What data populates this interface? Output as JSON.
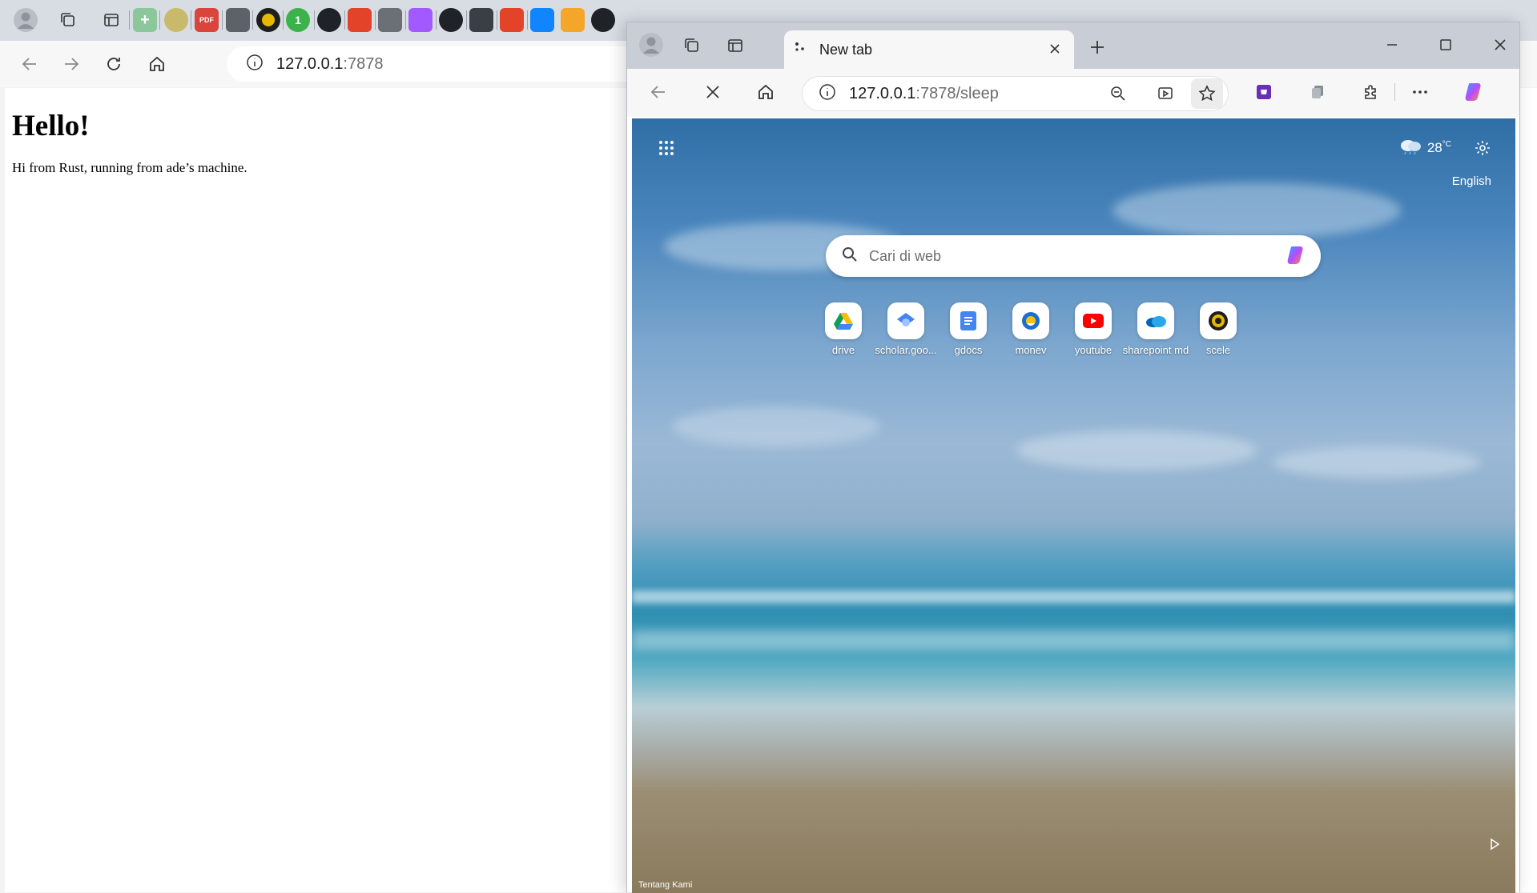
{
  "back_window": {
    "address": {
      "host": "127.0.0.1",
      "rest": ":7878"
    },
    "page": {
      "heading": "Hello!",
      "text": "Hi from Rust, running from ade’s machine."
    }
  },
  "front_window": {
    "tab": {
      "title": "New tab"
    },
    "address": {
      "host": "127.0.0.1",
      "rest": ":7878/sleep"
    },
    "newtab": {
      "weather_temp": "28",
      "weather_unit": "°C",
      "language": "English",
      "search_placeholder": "Cari di web",
      "quick_links": [
        {
          "label": "drive",
          "icon": "google-drive-icon"
        },
        {
          "label": "scholar.goo...",
          "icon": "google-scholar-icon"
        },
        {
          "label": "gdocs",
          "icon": "google-docs-icon"
        },
        {
          "label": "monev",
          "icon": "monev-icon"
        },
        {
          "label": "youtube",
          "icon": "youtube-icon"
        },
        {
          "label": "sharepoint md",
          "icon": "onedrive-cloud-icon"
        },
        {
          "label": "scele",
          "icon": "university-seal-icon"
        }
      ],
      "about_link": "Tentang Kami"
    }
  },
  "colors": {
    "accent": "#0078d4",
    "tabstrip": "#c9ced6",
    "toolbar": "#f7f7f7"
  }
}
